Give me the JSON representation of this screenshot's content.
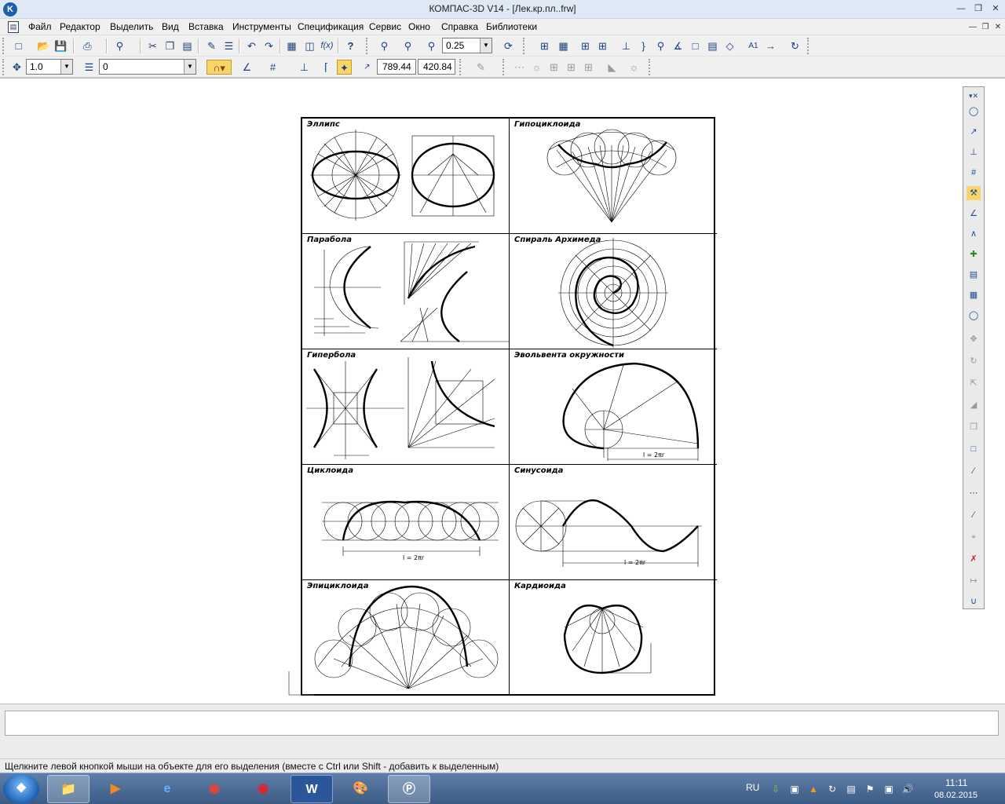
{
  "window": {
    "title": "КОМПАС-3D V14 - [Лек.кр.пл..frw]",
    "app_icon": "kompas-logo-icon"
  },
  "menu": {
    "items": [
      "Файл",
      "Редактор",
      "Выделить",
      "Вид",
      "Вставка",
      "Инструменты",
      "Спецификация",
      "Сервис",
      "Окно",
      "Справка",
      "Библиотеки"
    ]
  },
  "toolbar": {
    "zoom_value": "0.25",
    "line_scale": "1.0",
    "layer_value": "0",
    "coord_x": "789.44",
    "coord_y": "420.84"
  },
  "drawing": {
    "captions": [
      "Эллипс",
      "Гипоциклоида",
      "Парабола",
      "Спираль Архимеда",
      "Гипербола",
      "Эвольвента окружности",
      "Циклоида",
      "Синусоида",
      "Эпициклоида",
      "Кардиоида"
    ],
    "dim_labels": {
      "cycloid_len": "l = 2πr",
      "involute_len": "l = 2πr",
      "sine_len": "l = 2πr"
    }
  },
  "command_line": {
    "text": ""
  },
  "status": {
    "hint": "Щелкните левой кнопкой мыши на объекте для его выделения (вместе с Ctrl или Shift - добавить к выделенным)"
  },
  "taskbar": {
    "lang": "RU",
    "time": "11:11",
    "date": "08.02.2015"
  },
  "colors": {
    "titlebar": "#dfe9f5",
    "chrome": "#f0f0f0",
    "taskbar": "#3b5b85"
  }
}
